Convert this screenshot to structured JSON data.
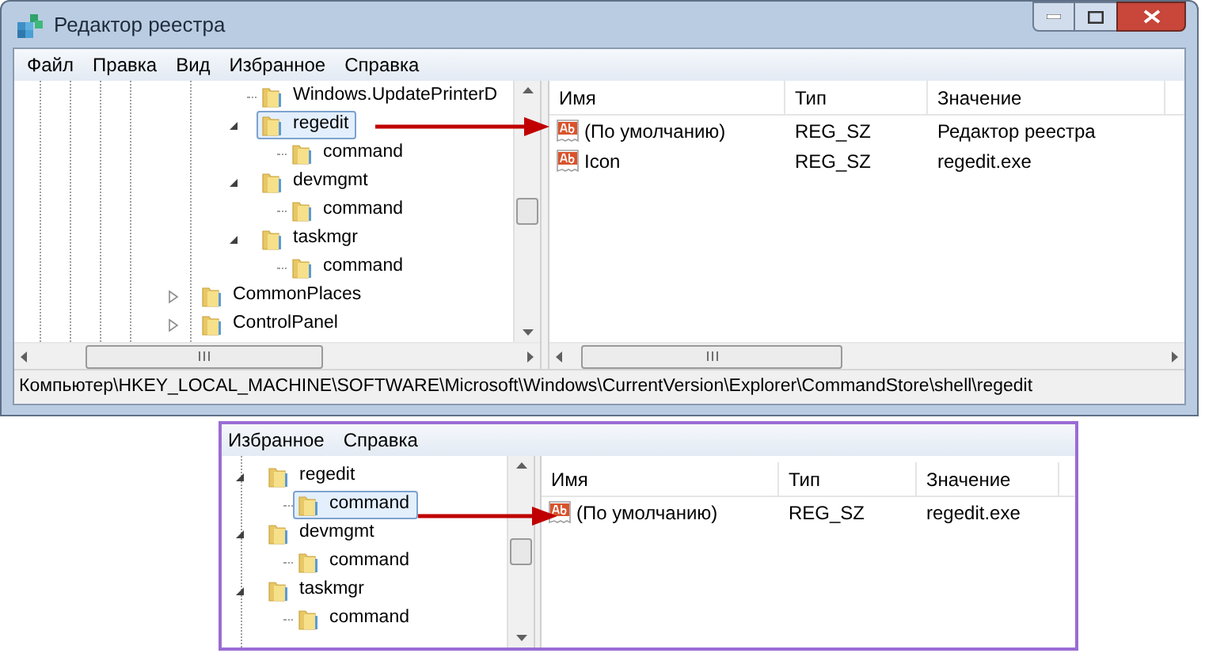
{
  "window": {
    "title": "Редактор реестра"
  },
  "menu": [
    "Файл",
    "Правка",
    "Вид",
    "Избранное",
    "Справка"
  ],
  "tree": [
    {
      "children": [
        {
          "children": [
            {
              "label": "Windows.UpdatePrinterD",
              "selected": false
            },
            {
              "label": "regedit",
              "selected": true,
              "expanded": true,
              "children": [
                {
                  "label": "command",
                  "selected": false
                }
              ]
            },
            {
              "label": "devmgmt",
              "selected": false,
              "expanded": true,
              "children": [
                {
                  "label": "command",
                  "selected": false
                }
              ]
            },
            {
              "label": "taskmgr",
              "selected": false,
              "expanded": true,
              "children": [
                {
                  "label": "command",
                  "selected": false
                }
              ]
            }
          ]
        }
      ]
    },
    {
      "label": "CommonPlaces",
      "selected": false,
      "expanded": false
    },
    {
      "label": "ControlPanel",
      "selected": false,
      "expanded": false
    }
  ],
  "values": {
    "columns": [
      "Имя",
      "Тип",
      "Значение"
    ],
    "rows": [
      [
        "(По умолчанию)",
        "REG_SZ",
        "Редактор реестра"
      ],
      [
        "Icon",
        "REG_SZ",
        "regedit.exe"
      ]
    ]
  },
  "status_bar": "Компьютер\\HKEY_LOCAL_MACHINE\\SOFTWARE\\Microsoft\\Windows\\CurrentVersion\\Explorer\\CommandStore\\shell\\regedit",
  "inset": {
    "menu": [
      "Избранное",
      "Справка"
    ],
    "tree": [
      {
        "label": "regedit",
        "selected": false,
        "expanded": true,
        "children": [
          {
            "label": "command",
            "selected": true
          }
        ]
      },
      {
        "label": "devmgmt",
        "selected": false,
        "expanded": true,
        "children": [
          {
            "label": "command",
            "selected": false
          }
        ]
      },
      {
        "label": "taskmgr",
        "selected": false,
        "expanded": true,
        "children": [
          {
            "label": "command",
            "selected": false
          }
        ]
      }
    ],
    "values": {
      "columns": [
        "Имя",
        "Тип",
        "Значение"
      ],
      "rows": [
        [
          "(По умолчанию)",
          "REG_SZ",
          "regedit.exe"
        ]
      ]
    }
  }
}
